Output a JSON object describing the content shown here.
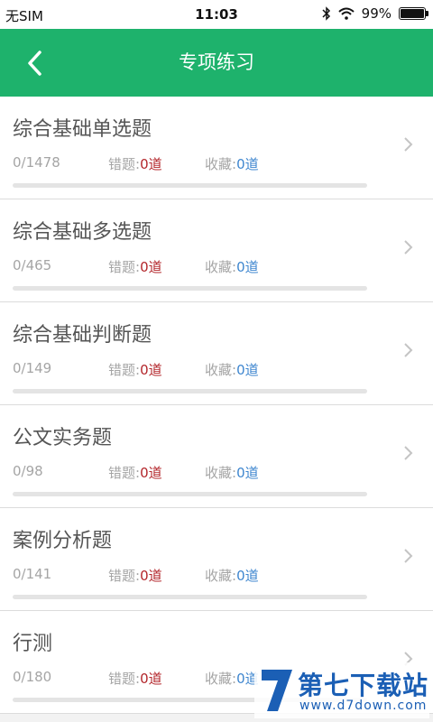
{
  "status": {
    "carrier": "无SIM",
    "time": "11:03",
    "battery": "99%",
    "battery_level": 0.99
  },
  "header": {
    "title": "专项练习"
  },
  "labels": {
    "wrong": "错题:",
    "fav": "收藏:"
  },
  "items": [
    {
      "title": "综合基础单选题",
      "count": "0/1478",
      "wrong": "0道",
      "fav": "0道",
      "progress": 0
    },
    {
      "title": "综合基础多选题",
      "count": "0/465",
      "wrong": "0道",
      "fav": "0道",
      "progress": 0
    },
    {
      "title": "综合基础判断题",
      "count": "0/149",
      "wrong": "0道",
      "fav": "0道",
      "progress": 0
    },
    {
      "title": "公文实务题",
      "count": "0/98",
      "wrong": "0道",
      "fav": "0道",
      "progress": 0
    },
    {
      "title": "案例分析题",
      "count": "0/141",
      "wrong": "0道",
      "fav": "0道",
      "progress": 0
    },
    {
      "title": "行测",
      "count": "0/180",
      "wrong": "0道",
      "fav": "0道",
      "progress": 0
    }
  ],
  "watermark": {
    "name": "第七下载站",
    "url": "www.d7down.com"
  },
  "colors": {
    "header": "#1eb26c",
    "wrong": "#b3262b",
    "fav": "#3e86cf"
  }
}
